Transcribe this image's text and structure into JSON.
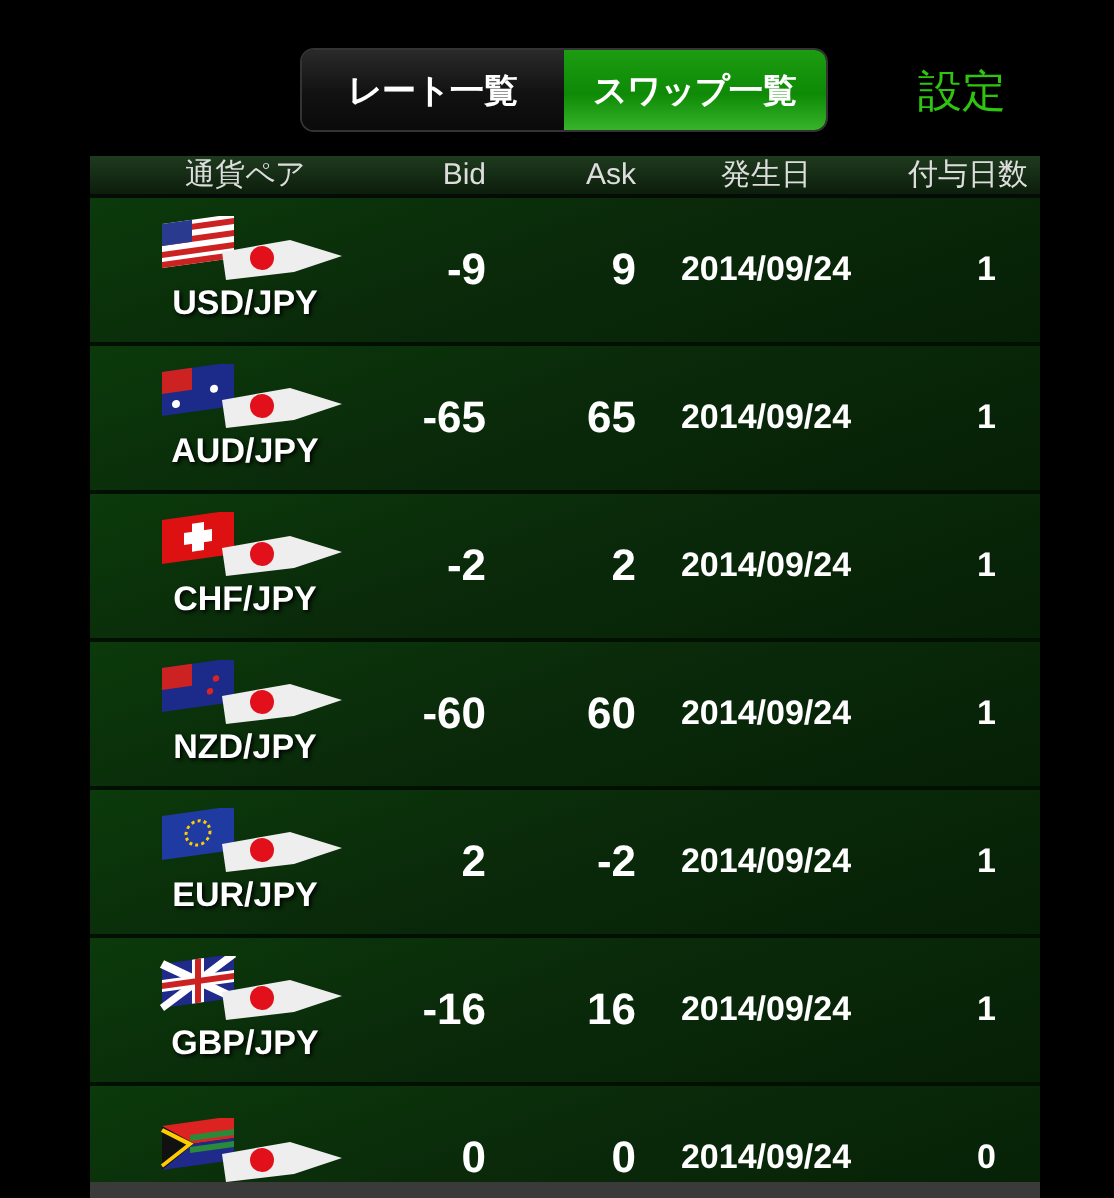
{
  "tabs": [
    {
      "label": "レート一覧",
      "selected": false
    },
    {
      "label": "スワップ一覧",
      "selected": true
    }
  ],
  "settings": "設定",
  "table": {
    "columns": [
      "通貨ペア",
      "Bid",
      "Ask",
      "発生日",
      "付与日数"
    ],
    "rows": [
      {
        "pair": "USD/JPY",
        "bid": "-9",
        "ask": "9",
        "date": "2014/09/24",
        "days": "1"
      },
      {
        "pair": "AUD/JPY",
        "bid": "-65",
        "ask": "65",
        "date": "2014/09/24",
        "days": "1"
      },
      {
        "pair": "CHF/JPY",
        "bid": "-2",
        "ask": "2",
        "date": "2014/09/24",
        "days": "1"
      },
      {
        "pair": "NZD/JPY",
        "bid": "-60",
        "ask": "60",
        "date": "2014/09/24",
        "days": "1"
      },
      {
        "pair": "EUR/JPY",
        "bid": "2",
        "ask": "-2",
        "date": "2014/09/24",
        "days": "1"
      },
      {
        "pair": "GBP/JPY",
        "bid": "-16",
        "ask": "16",
        "date": "2014/09/24",
        "days": "1"
      },
      {
        "bid": "0",
        "ask": "0",
        "date": "2014/09/24",
        "days": "0"
      }
    ]
  }
}
